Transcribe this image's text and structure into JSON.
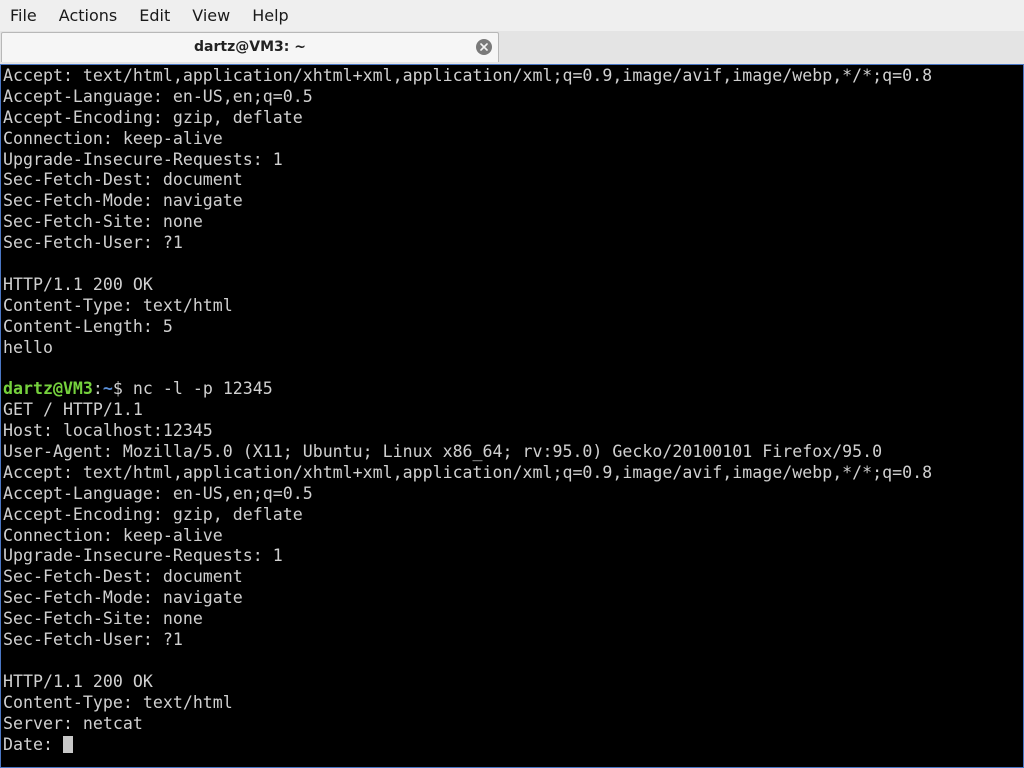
{
  "menubar": {
    "items": [
      "File",
      "Actions",
      "Edit",
      "View",
      "Help"
    ]
  },
  "tab": {
    "title": "dartz@VM3: ~"
  },
  "terminal": {
    "lines_before_prompt": [
      "Accept: text/html,application/xhtml+xml,application/xml;q=0.9,image/avif,image/webp,*/*;q=0.8",
      "Accept-Language: en-US,en;q=0.5",
      "Accept-Encoding: gzip, deflate",
      "Connection: keep-alive",
      "Upgrade-Insecure-Requests: 1",
      "Sec-Fetch-Dest: document",
      "Sec-Fetch-Mode: navigate",
      "Sec-Fetch-Site: none",
      "Sec-Fetch-User: ?1",
      "",
      "HTTP/1.1 200 OK",
      "Content-Type: text/html",
      "Content-Length: 5",
      "hello",
      ""
    ],
    "prompt": {
      "user_host": "dartz@VM3",
      "separator": ":",
      "path": "~",
      "symbol": "$ ",
      "command": "nc -l -p 12345"
    },
    "lines_after_prompt": [
      "GET / HTTP/1.1",
      "Host: localhost:12345",
      "User-Agent: Mozilla/5.0 (X11; Ubuntu; Linux x86_64; rv:95.0) Gecko/20100101 Firefox/95.0",
      "Accept: text/html,application/xhtml+xml,application/xml;q=0.9,image/avif,image/webp,*/*;q=0.8",
      "Accept-Language: en-US,en;q=0.5",
      "Accept-Encoding: gzip, deflate",
      "Connection: keep-alive",
      "Upgrade-Insecure-Requests: 1",
      "Sec-Fetch-Dest: document",
      "Sec-Fetch-Mode: navigate",
      "Sec-Fetch-Site: none",
      "Sec-Fetch-User: ?1",
      "",
      "HTTP/1.1 200 OK",
      "Content-Type: text/html",
      "Server: netcat"
    ],
    "input_line": "Date: "
  }
}
